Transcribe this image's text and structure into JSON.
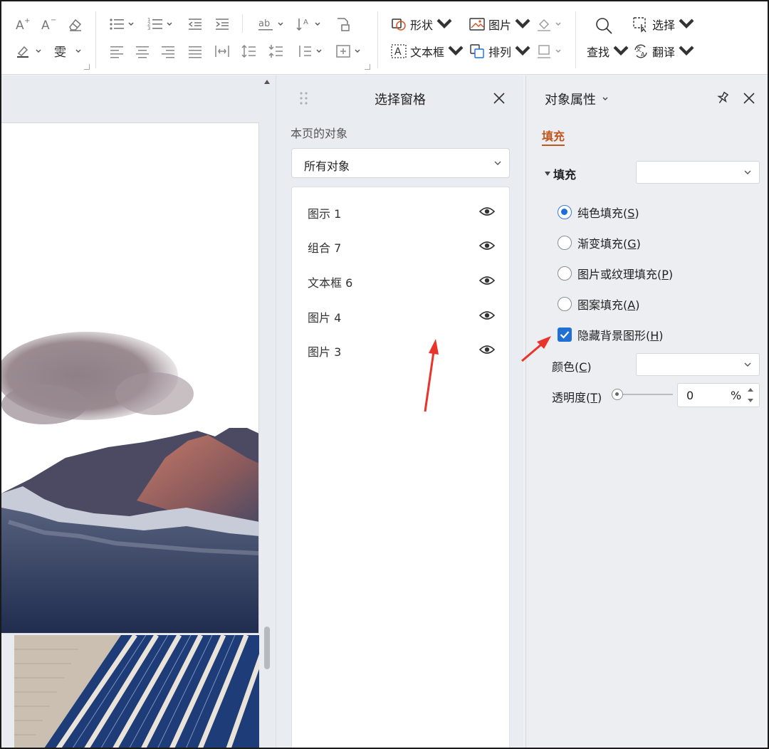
{
  "ribbon": {
    "shape_label": "形状",
    "picture_label": "图片",
    "textbox_label": "文本框",
    "arrange_label": "排列",
    "find_label": "查找",
    "select_label": "选择",
    "translate_label": "翻译",
    "text_style_glyph": "A"
  },
  "selection_pane": {
    "title": "选择窗格",
    "subtitle": "本页的对象",
    "filter_value": "所有对象",
    "items": [
      {
        "label": "图示 1"
      },
      {
        "label": "组合 7"
      },
      {
        "label": "文本框 6"
      },
      {
        "label": "图片 4"
      },
      {
        "label": "图片 3"
      }
    ]
  },
  "property_pane": {
    "title": "对象属性",
    "tab": "填充",
    "section": "填充",
    "options": [
      {
        "label": "纯色填充(",
        "key": "S",
        "selected": true
      },
      {
        "label": "渐变填充(",
        "key": "G",
        "selected": false
      },
      {
        "label": "图片或纹理填充(",
        "key": "P",
        "selected": false
      },
      {
        "label": "图案填充(",
        "key": "A",
        "selected": false
      }
    ],
    "hide_bg": {
      "label": "隐藏背景图形(",
      "key": "H",
      "checked": true
    },
    "color_label": "颜色(",
    "color_key": "C",
    "transparency_label": "透明度(",
    "transparency_key": "T",
    "transparency_value": "0",
    "transparency_unit": "%"
  },
  "colors": {
    "accent": "#1f6fd4",
    "tab_orange": "#c0561e",
    "arrow_red": "#e8342a"
  }
}
